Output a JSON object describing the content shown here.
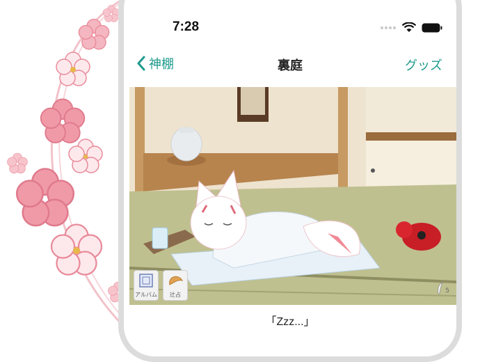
{
  "status_bar": {
    "time": "7:28"
  },
  "nav": {
    "back_label": "神棚",
    "title": "裏庭",
    "goods_label": "グッズ"
  },
  "scene": {
    "album_label": "アルバム",
    "fortune_label": "辻占",
    "feather_count": "5"
  },
  "caption": "「Zzz...」",
  "colors": {
    "accent": "#1e9a8c",
    "sakura": "#f2a6b4",
    "tatami": "#bdbd91"
  }
}
